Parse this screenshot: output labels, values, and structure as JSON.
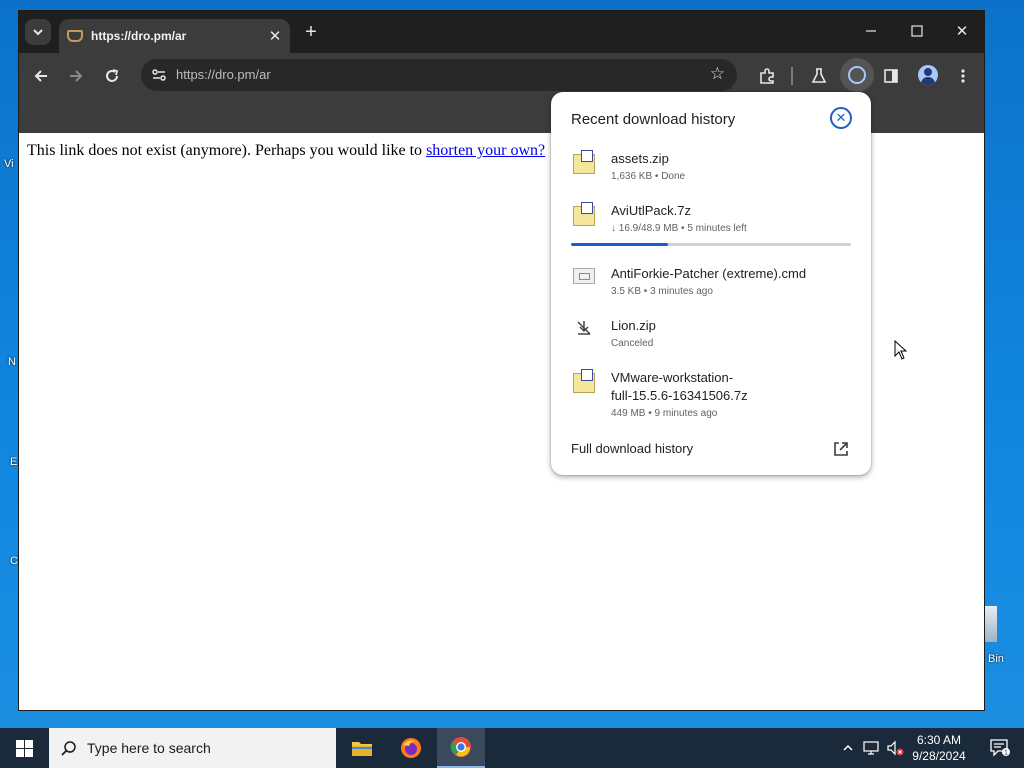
{
  "desktop": {
    "fragments": [
      "Vi",
      "N",
      "E",
      "C"
    ],
    "recycle_bin_label": "Bin"
  },
  "browser": {
    "tab": {
      "title": "https://dro.pm/ar"
    },
    "omnibox": {
      "url": "https://dro.pm/ar"
    },
    "page": {
      "message": "This link does not exist (anymore). Perhaps you would like to ",
      "link_text": "shorten your own?"
    }
  },
  "downloads_bubble": {
    "title": "Recent download history",
    "items": [
      {
        "name": "assets.zip",
        "status": "1,636 KB • Done",
        "icon": "zip-file-icon"
      },
      {
        "name": "AviUtlPack.7z",
        "status": "↓ 16.9/48.9 MB • 5 minutes left",
        "icon": "zip-file-icon",
        "progress": 0.345
      },
      {
        "name": "AntiForkie-Patcher (extreme).cmd",
        "status": "3.5 KB • 3 minutes ago",
        "icon": "cmd-file-icon"
      },
      {
        "name": "Lion.zip",
        "status": "Canceled",
        "icon": "canceled-download-icon"
      },
      {
        "name_line1": "VMware-workstation-",
        "name_line2": "full-15.5.6-16341506.7z",
        "status": "449 MB • 9 minutes ago",
        "icon": "zip-file-icon"
      }
    ],
    "footer": "Full download history"
  },
  "taskbar": {
    "search_placeholder": "Type here to search",
    "time": "6:30 AM",
    "date": "9/28/2024",
    "notification_count": "1"
  },
  "colors": {
    "accent_blue": "#1a5fd0",
    "chrome_dark": "#3c3c3c",
    "link": "#0000ee"
  }
}
